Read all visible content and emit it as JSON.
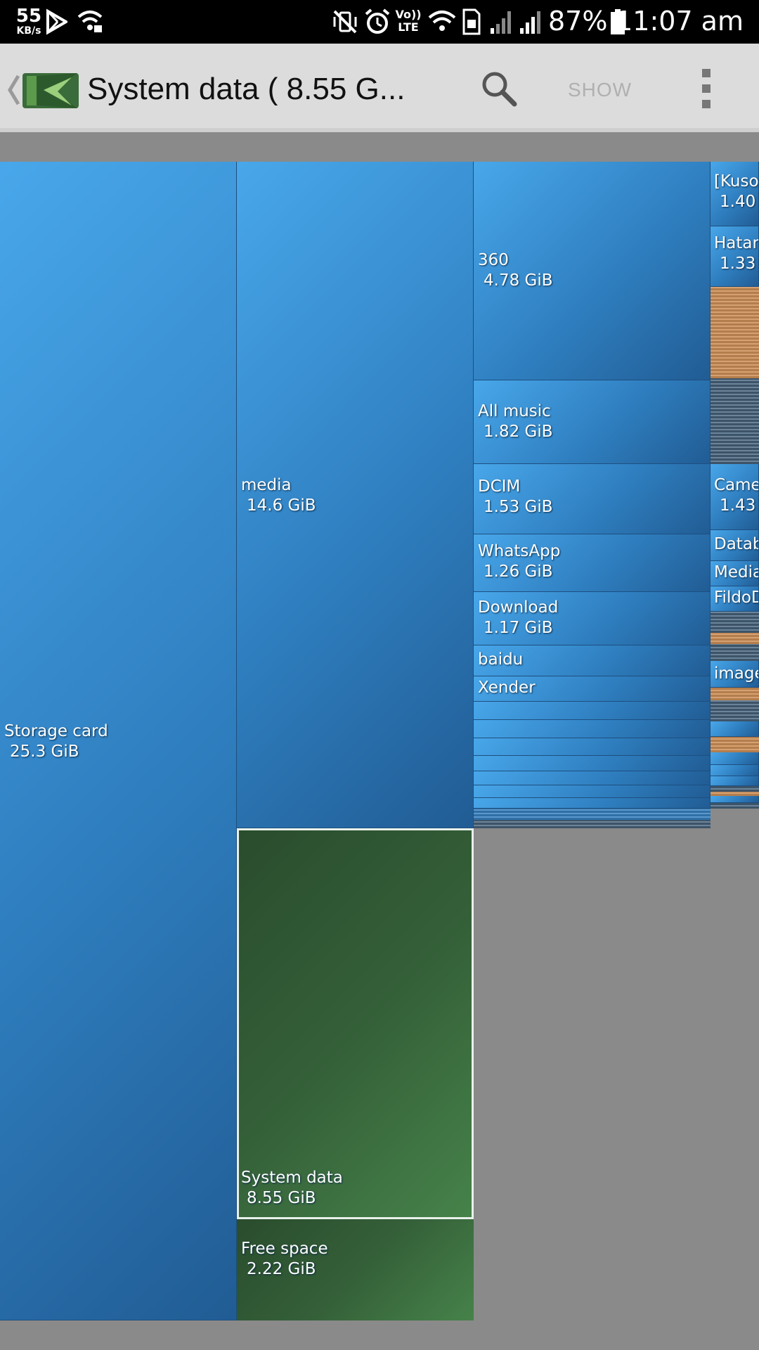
{
  "status_bar": {
    "net_speed": "55",
    "net_unit": "KB/s",
    "network_label": "Vo)) LTE",
    "battery": "87%",
    "time": "11:07 am",
    "icons": [
      "play-store-icon",
      "wifi-lock-icon",
      "mute-icon",
      "alarm-icon",
      "volte-icon",
      "wifi-icon",
      "sim-icon",
      "signal-icon",
      "signal-icon",
      "battery-icon"
    ]
  },
  "toolbar": {
    "title": "System data ( 8.55 G...",
    "show_label": "SHOW",
    "icons": [
      "back-chevron-icon",
      "app-logo-icon",
      "search-icon",
      "more-vert-icon"
    ]
  },
  "colors": {
    "folder_blue": "#3a8fd6",
    "system_green": "#355f38",
    "file_orange": "#c58d5c",
    "file_gray": "#4f6679",
    "background_gray": "#8a8a8a"
  },
  "treemap": {
    "storage_card": {
      "name": "Storage card",
      "size": "25.3 GiB"
    },
    "media": {
      "name": "media",
      "size": "14.6 GiB"
    },
    "system_data": {
      "name": "System data",
      "size": "8.55 GiB"
    },
    "free_space": {
      "name": "Free space",
      "size": "2.22 GiB"
    },
    "folders": [
      {
        "name": "360",
        "size": "4.78 GiB"
      },
      {
        "name": "All music",
        "size": "1.82 GiB"
      },
      {
        "name": "DCIM",
        "size": "1.53 GiB"
      },
      {
        "name": "WhatsApp",
        "size": "1.26 GiB"
      },
      {
        "name": "Download",
        "size": "1.17 GiB"
      },
      {
        "name": "baidu",
        "size": ""
      },
      {
        "name": "Xender",
        "size": ""
      }
    ],
    "subfolders": [
      {
        "name": "[Kuso",
        "size": "1.40"
      },
      {
        "name": "Hatar",
        "size": "1.33"
      },
      {
        "name": "Camer",
        "size": "1.43"
      },
      {
        "name": "Datab",
        "size": ""
      },
      {
        "name": "Media",
        "size": ""
      },
      {
        "name": "FildoD",
        "size": ""
      },
      {
        "name": "image",
        "size": ""
      }
    ]
  }
}
